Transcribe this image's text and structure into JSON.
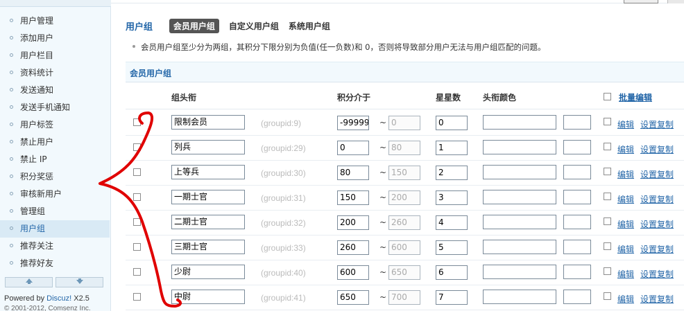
{
  "sidebar": {
    "items": [
      {
        "label": "用户管理",
        "active": false
      },
      {
        "label": "添加用户",
        "active": false
      },
      {
        "label": "用户栏目",
        "active": false
      },
      {
        "label": "资料统计",
        "active": false
      },
      {
        "label": "发送通知",
        "active": false
      },
      {
        "label": "发送手机通知",
        "active": false
      },
      {
        "label": "用户标签",
        "active": false
      },
      {
        "label": "禁止用户",
        "active": false
      },
      {
        "label": "禁止 IP",
        "active": false
      },
      {
        "label": "积分奖惩",
        "active": false
      },
      {
        "label": "审核新用户",
        "active": false
      },
      {
        "label": "管理组",
        "active": false
      },
      {
        "label": "用户组",
        "active": true
      },
      {
        "label": "推荐关注",
        "active": false
      },
      {
        "label": "推荐好友",
        "active": false
      }
    ],
    "scroll_up_icon": "arrow-up-icon",
    "scroll_down_icon": "arrow-down-icon",
    "powered_prefix": "Powered by ",
    "powered_brand": "Discuz!",
    "powered_version": " X2.5",
    "copyright": "© 2001-2012, Comsenz Inc."
  },
  "header": {
    "title": "用户组",
    "tabs": [
      {
        "label": "会员用户组",
        "active": true
      },
      {
        "label": "自定义用户组",
        "active": false
      },
      {
        "label": "系统用户组",
        "active": false
      }
    ]
  },
  "tip": "会员用户组至少分为两组，其积分下限分别为负值(任一负数)和  0，否则将导致部分用户无法与用户组匹配的问题。",
  "section_title": "会员用户组",
  "table": {
    "columns": {
      "title": "组头衔",
      "credits_range": "积分介于",
      "stars": "星星数",
      "color": "头衔颜色",
      "batch_edit": "批量编辑"
    },
    "tilde": "~",
    "edit_label": "编辑",
    "copy_label": "设置复制",
    "rows": [
      {
        "name": "限制会员",
        "groupid": "(groupid:9)",
        "low": "-99999",
        "high": "0",
        "stars": "0",
        "color": ""
      },
      {
        "name": "列兵",
        "groupid": "(groupid:29)",
        "low": "0",
        "high": "80",
        "stars": "1",
        "color": ""
      },
      {
        "name": "上等兵",
        "groupid": "(groupid:30)",
        "low": "80",
        "high": "150",
        "stars": "2",
        "color": ""
      },
      {
        "name": "一期士官",
        "groupid": "(groupid:31)",
        "low": "150",
        "high": "200",
        "stars": "3",
        "color": ""
      },
      {
        "name": "二期士官",
        "groupid": "(groupid:32)",
        "low": "200",
        "high": "260",
        "stars": "4",
        "color": ""
      },
      {
        "name": "三期士官",
        "groupid": "(groupid:33)",
        "low": "260",
        "high": "600",
        "stars": "5",
        "color": ""
      },
      {
        "name": "少尉",
        "groupid": "(groupid:40)",
        "low": "600",
        "high": "650",
        "stars": "6",
        "color": ""
      },
      {
        "name": "中尉",
        "groupid": "(groupid:41)",
        "low": "650",
        "high": "700",
        "stars": "7",
        "color": ""
      }
    ]
  },
  "colors": {
    "accent": "#2366a8",
    "annotation": "#e00000",
    "sidebar_bg": "#f2f9fd"
  }
}
